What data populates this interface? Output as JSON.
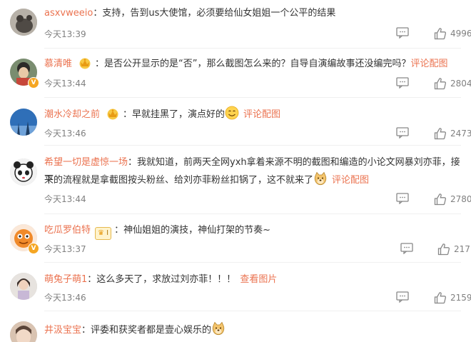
{
  "comments": [
    {
      "user": "asxvweeio",
      "text": "支持，告到us大使馆，必须要给仙女姐姐一个公平的结果",
      "time": "今天13:39",
      "likes": "4996"
    },
    {
      "user": "慕清唯",
      "text": "是否公开显示的是“否”，那么截图怎么来的？自导自演编故事还没编完吗？",
      "link": "评论配图",
      "time": "今天13:44",
      "likes": "2804"
    },
    {
      "user": "潮水冷却之前",
      "text": "早就挂黑了，演点好的",
      "link": "评论配图",
      "time": "今天13:46",
      "likes": "2473"
    },
    {
      "user": "希望一切是虚惊一场",
      "text_line1": "我就知道，前两天全网yxh拿着来源不明的截图和编造的小论文网暴刘亦菲，接下",
      "text_line2": "来的流程就是拿截图按头粉丝、给刘亦菲粉丝扣锅了，这不就来了",
      "link": "评论配图",
      "time": "今天13:44",
      "likes": "2780"
    },
    {
      "user": "吃瓜罗伯特",
      "level": "I",
      "text": "神仙姐姐的演技，神仙打架的节奏~",
      "time": "今天13:37",
      "likes": "217"
    },
    {
      "user": "萌兔子萌1",
      "text": "这么多天了，求放过刘亦菲！！！",
      "link": "查看图片",
      "time": "今天13:46",
      "likes": "2159"
    },
    {
      "user": "井汲宝宝",
      "text": "评委和获奖者都是壹心娱乐的"
    }
  ],
  "colors": {
    "username": "#eb7350",
    "text": "#333333",
    "meta": "#808080"
  },
  "icons": [
    "comment-icon",
    "like-icon",
    "crown-badge",
    "doge-emoji",
    "smile-emoji"
  ]
}
